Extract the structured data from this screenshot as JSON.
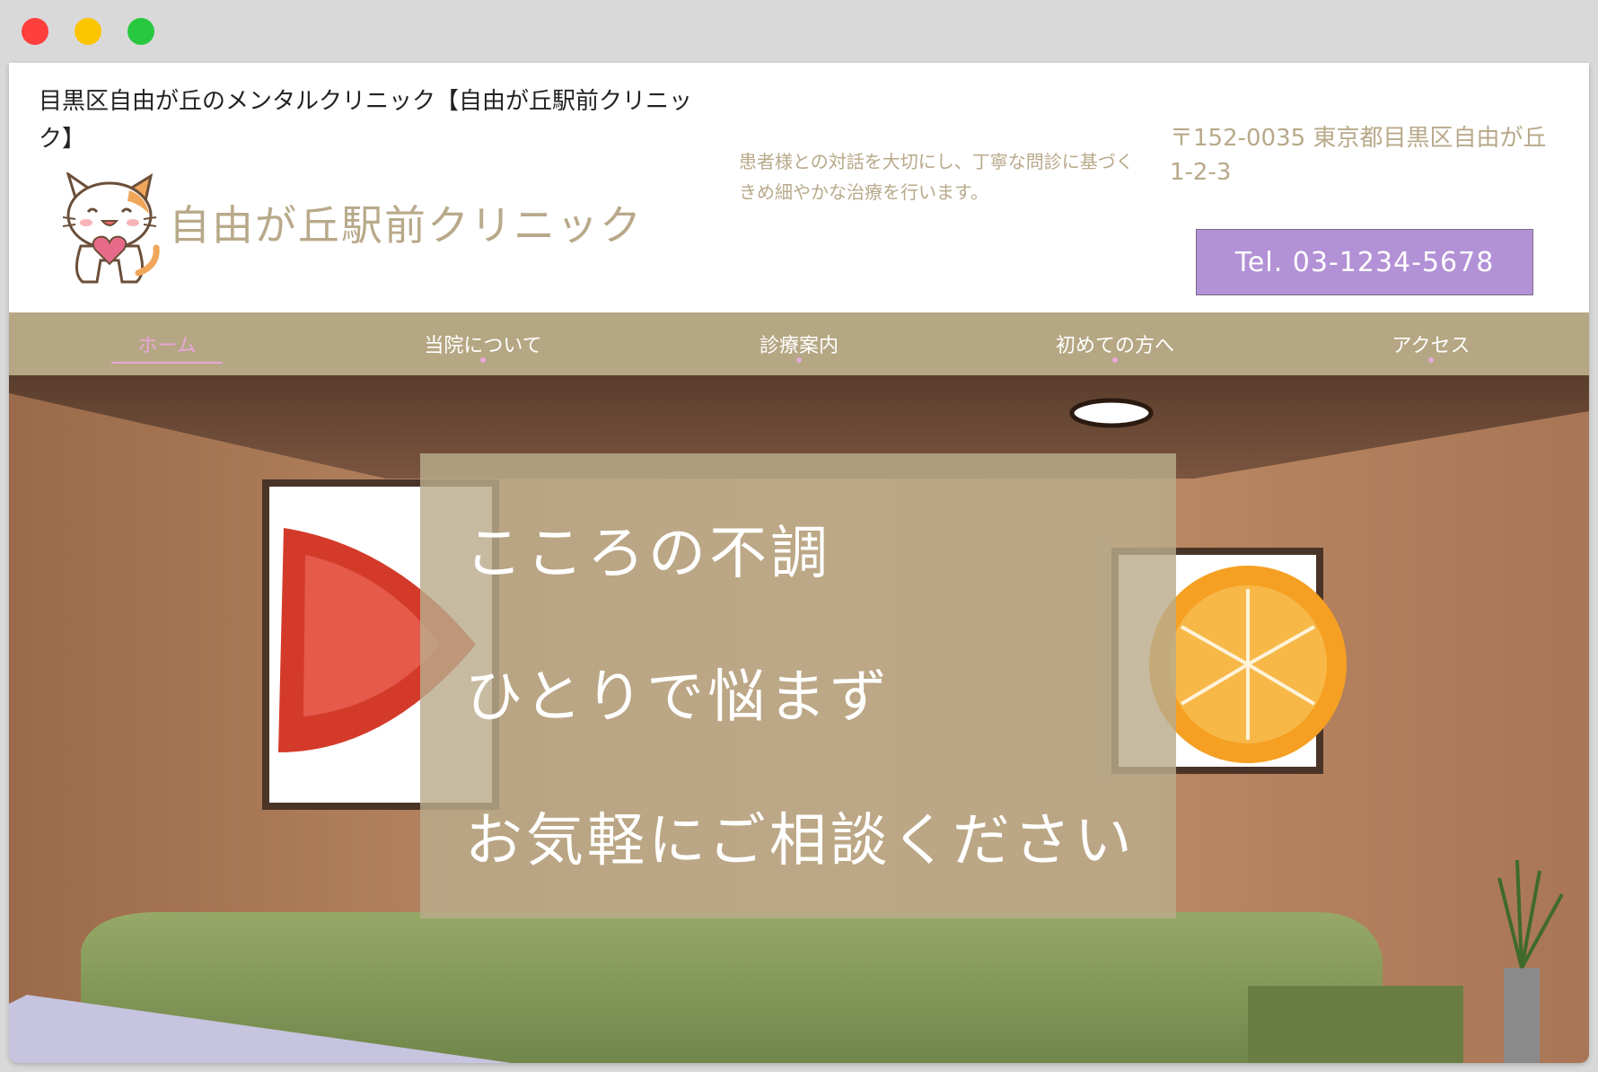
{
  "site_title": "目黒区自由が丘のメンタルクリニック【自由が丘駅前クリニック】",
  "logo_text": "自由が丘駅前クリニック",
  "tagline": "患者様との対話を大切にし、丁寧な問診に基づくきめ細やかな治療を行います。",
  "address": "〒152-0035 東京都目黒区自由が丘1-2-3",
  "tel_label": "Tel. 03-1234-5678",
  "nav": [
    {
      "label": "ホーム",
      "active": true
    },
    {
      "label": "当院について",
      "active": false
    },
    {
      "label": "診療案内",
      "active": false
    },
    {
      "label": "初めての方へ",
      "active": false
    },
    {
      "label": "アクセス",
      "active": false
    }
  ],
  "hero": {
    "lines": [
      "こころの不調",
      "ひとりで悩まず",
      "お気軽にご相談ください"
    ]
  },
  "colors": {
    "accent_beige": "#b5a783",
    "tel_purple": "#b391d6",
    "nav_active_pink": "#e8a6d8"
  },
  "icons": [
    "cat-mascot-logo"
  ]
}
